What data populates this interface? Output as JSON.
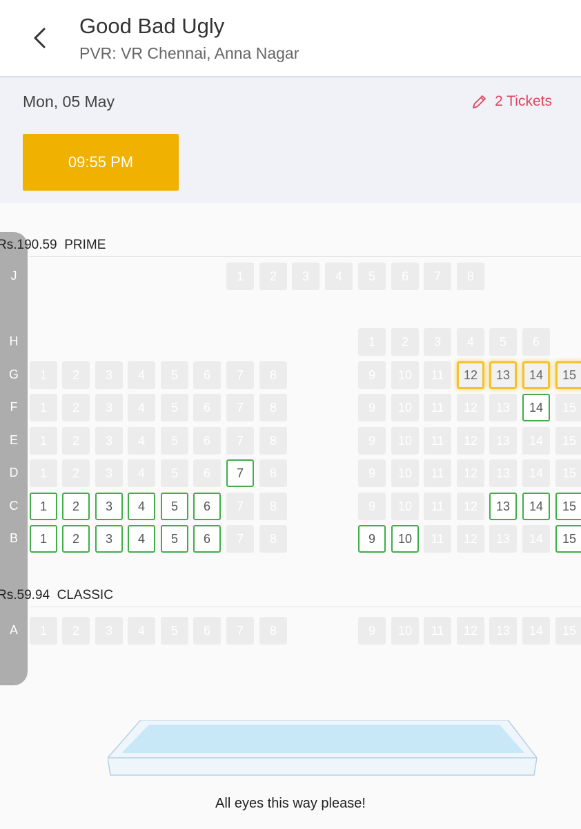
{
  "header": {
    "title": "Good Bad Ugly",
    "subtitle": "PVR: VR Chennai, Anna Nagar",
    "back_icon": "chevron-left-icon"
  },
  "info": {
    "date": "Mon, 05 May",
    "tickets_label": "2 Tickets",
    "edit_icon": "pencil-icon",
    "showtime": "09:55 PM"
  },
  "colors": {
    "accent": "#f0b100",
    "tickets": "#e0455e",
    "available_border": "#3fae49",
    "sold": "#ececec",
    "selected_glow": "#f2c230"
  },
  "sections": [
    {
      "price": "Rs.190.59",
      "name": "PRIME"
    },
    {
      "price": "Rs.59.94",
      "name": "CLASSIC"
    }
  ],
  "rows": [
    {
      "label": "J",
      "seats": [
        {
          "n": "1",
          "s": "sold"
        },
        {
          "n": "2",
          "s": "sold"
        },
        {
          "n": "3",
          "s": "sold"
        },
        {
          "n": "4",
          "s": "sold"
        },
        {
          "n": "5",
          "s": "sold"
        },
        {
          "n": "6",
          "s": "sold"
        },
        {
          "n": "7",
          "s": "sold"
        },
        {
          "n": "8",
          "s": "sold"
        }
      ]
    },
    {
      "label": "H",
      "seats": [
        {
          "n": "1",
          "s": "sold"
        },
        {
          "n": "2",
          "s": "sold"
        },
        {
          "n": "3",
          "s": "sold"
        },
        {
          "n": "4",
          "s": "sold"
        },
        {
          "n": "5",
          "s": "sold"
        },
        {
          "n": "6",
          "s": "sold"
        }
      ]
    },
    {
      "label": "G",
      "seats": [
        {
          "n": "1",
          "s": "sold"
        },
        {
          "n": "2",
          "s": "sold"
        },
        {
          "n": "3",
          "s": "sold"
        },
        {
          "n": "4",
          "s": "sold"
        },
        {
          "n": "5",
          "s": "sold"
        },
        {
          "n": "6",
          "s": "sold"
        },
        {
          "n": "7",
          "s": "sold"
        },
        {
          "n": "8",
          "s": "sold"
        },
        {
          "n": "9",
          "s": "sold"
        },
        {
          "n": "10",
          "s": "sold"
        },
        {
          "n": "11",
          "s": "sold"
        },
        {
          "n": "12",
          "s": "selected"
        },
        {
          "n": "13",
          "s": "selected"
        },
        {
          "n": "14",
          "s": "selected"
        },
        {
          "n": "15",
          "s": "selected"
        }
      ]
    },
    {
      "label": "F",
      "seats": [
        {
          "n": "1",
          "s": "sold"
        },
        {
          "n": "2",
          "s": "sold"
        },
        {
          "n": "3",
          "s": "sold"
        },
        {
          "n": "4",
          "s": "sold"
        },
        {
          "n": "5",
          "s": "sold"
        },
        {
          "n": "6",
          "s": "sold"
        },
        {
          "n": "7",
          "s": "sold"
        },
        {
          "n": "8",
          "s": "sold"
        },
        {
          "n": "9",
          "s": "sold"
        },
        {
          "n": "10",
          "s": "sold"
        },
        {
          "n": "11",
          "s": "sold"
        },
        {
          "n": "12",
          "s": "sold"
        },
        {
          "n": "13",
          "s": "sold"
        },
        {
          "n": "14",
          "s": "available"
        },
        {
          "n": "15",
          "s": "sold"
        }
      ]
    },
    {
      "label": "E",
      "seats": [
        {
          "n": "1",
          "s": "sold"
        },
        {
          "n": "2",
          "s": "sold"
        },
        {
          "n": "3",
          "s": "sold"
        },
        {
          "n": "4",
          "s": "sold"
        },
        {
          "n": "5",
          "s": "sold"
        },
        {
          "n": "6",
          "s": "sold"
        },
        {
          "n": "7",
          "s": "sold"
        },
        {
          "n": "8",
          "s": "sold"
        },
        {
          "n": "9",
          "s": "sold"
        },
        {
          "n": "10",
          "s": "sold"
        },
        {
          "n": "11",
          "s": "sold"
        },
        {
          "n": "12",
          "s": "sold"
        },
        {
          "n": "13",
          "s": "sold"
        },
        {
          "n": "14",
          "s": "sold"
        },
        {
          "n": "15",
          "s": "sold"
        }
      ]
    },
    {
      "label": "D",
      "seats": [
        {
          "n": "1",
          "s": "sold"
        },
        {
          "n": "2",
          "s": "sold"
        },
        {
          "n": "3",
          "s": "sold"
        },
        {
          "n": "4",
          "s": "sold"
        },
        {
          "n": "5",
          "s": "sold"
        },
        {
          "n": "6",
          "s": "sold"
        },
        {
          "n": "7",
          "s": "available"
        },
        {
          "n": "8",
          "s": "sold"
        },
        {
          "n": "9",
          "s": "sold"
        },
        {
          "n": "10",
          "s": "sold"
        },
        {
          "n": "11",
          "s": "sold"
        },
        {
          "n": "12",
          "s": "sold"
        },
        {
          "n": "13",
          "s": "sold"
        },
        {
          "n": "14",
          "s": "sold"
        },
        {
          "n": "15",
          "s": "sold"
        }
      ]
    },
    {
      "label": "C",
      "seats": [
        {
          "n": "1",
          "s": "available"
        },
        {
          "n": "2",
          "s": "available"
        },
        {
          "n": "3",
          "s": "available"
        },
        {
          "n": "4",
          "s": "available"
        },
        {
          "n": "5",
          "s": "available"
        },
        {
          "n": "6",
          "s": "available"
        },
        {
          "n": "7",
          "s": "sold"
        },
        {
          "n": "8",
          "s": "sold"
        },
        {
          "n": "9",
          "s": "sold"
        },
        {
          "n": "10",
          "s": "sold"
        },
        {
          "n": "11",
          "s": "sold"
        },
        {
          "n": "12",
          "s": "sold"
        },
        {
          "n": "13",
          "s": "available"
        },
        {
          "n": "14",
          "s": "available"
        },
        {
          "n": "15",
          "s": "available"
        }
      ]
    },
    {
      "label": "B",
      "seats": [
        {
          "n": "1",
          "s": "available"
        },
        {
          "n": "2",
          "s": "available"
        },
        {
          "n": "3",
          "s": "available"
        },
        {
          "n": "4",
          "s": "available"
        },
        {
          "n": "5",
          "s": "available"
        },
        {
          "n": "6",
          "s": "available"
        },
        {
          "n": "7",
          "s": "sold"
        },
        {
          "n": "8",
          "s": "sold"
        },
        {
          "n": "9",
          "s": "available"
        },
        {
          "n": "10",
          "s": "available"
        },
        {
          "n": "11",
          "s": "sold"
        },
        {
          "n": "12",
          "s": "sold"
        },
        {
          "n": "13",
          "s": "sold"
        },
        {
          "n": "14",
          "s": "sold"
        },
        {
          "n": "15",
          "s": "available"
        }
      ]
    },
    {
      "label": "A",
      "seats": [
        {
          "n": "1",
          "s": "sold"
        },
        {
          "n": "2",
          "s": "sold"
        },
        {
          "n": "3",
          "s": "sold"
        },
        {
          "n": "4",
          "s": "sold"
        },
        {
          "n": "5",
          "s": "sold"
        },
        {
          "n": "6",
          "s": "sold"
        },
        {
          "n": "7",
          "s": "sold"
        },
        {
          "n": "8",
          "s": "sold"
        },
        {
          "n": "9",
          "s": "sold"
        },
        {
          "n": "10",
          "s": "sold"
        },
        {
          "n": "11",
          "s": "sold"
        },
        {
          "n": "12",
          "s": "sold"
        },
        {
          "n": "13",
          "s": "sold"
        },
        {
          "n": "14",
          "s": "sold"
        },
        {
          "n": "15",
          "s": "sold"
        }
      ]
    }
  ],
  "screen": {
    "caption": "All eyes this way please!"
  }
}
